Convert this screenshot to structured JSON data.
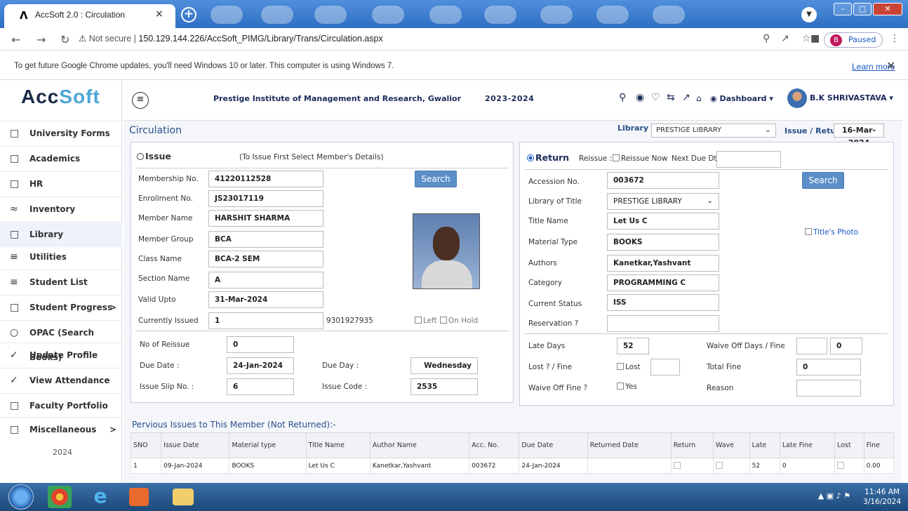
{
  "browser": {
    "tab_title": "AccSoft 2.0 : Circulation",
    "tab_logo": "Λ",
    "close_tab": "×",
    "new_tab": "+",
    "not_secure": "Not secure",
    "url": "150.129.144.226/AccSoft_PIMG/Library/Trans/Circulation.aspx",
    "profile_initial": "B",
    "profile_status": "Paused",
    "info_message": "To get future Google Chrome updates, you'll need Windows 10 or later. This computer is using Windows 7.",
    "learn_more": "Learn more"
  },
  "sidebar": {
    "brand_a": "Acc",
    "brand_b": "Soft",
    "items": [
      {
        "label": "University Forms",
        "icon": "□"
      },
      {
        "label": "Academics",
        "icon": "□"
      },
      {
        "label": "HR",
        "icon": "□"
      },
      {
        "label": "Inventory",
        "icon": "≈"
      },
      {
        "label": "Library",
        "icon": "□"
      },
      {
        "label": "Utilities",
        "icon": "≡"
      },
      {
        "label": "Student List",
        "icon": "≡"
      },
      {
        "label": "Student Progress",
        "icon": "□"
      },
      {
        "label": "OPAC (Search Books)",
        "icon": "○"
      },
      {
        "label": "Update Profile",
        "icon": "✓"
      },
      {
        "label": "View Attendance",
        "icon": "✓"
      },
      {
        "label": "Faculty Portfolio",
        "icon": "□"
      },
      {
        "label": "Miscellaneous",
        "icon": "□"
      }
    ],
    "arrow": ">",
    "year": "2024"
  },
  "header": {
    "institute": "Prestige Institute of Management and Research, Gwalior",
    "session": "2023-2024",
    "dashboard": "Dashboard",
    "user": "B.K SHRIVASTAVA"
  },
  "page": {
    "title": "Circulation",
    "library_label": "Library :",
    "library_value": "PRESTIGE LIBRARY",
    "issue_return_label": "Issue / Return Date :",
    "issue_return_date": "16-Mar-2024"
  },
  "issue": {
    "heading": "Issue",
    "hint": "(To Issue First Select Member's Details)",
    "search": "Search",
    "membership_label": "Membership No.",
    "membership_no": "41220112528",
    "enrollment_label": "Enrollment No.",
    "enrollment_no": "JS23017119",
    "member_name_label": "Member Name",
    "member_name": "HARSHIT SHARMA",
    "member_group_label": "Member Group",
    "member_group": "BCA",
    "class_label": "Class Name",
    "class_name": "BCA-2 SEM",
    "section_label": "Section Name",
    "section_name": "A",
    "valid_label": "Valid Upto",
    "valid_upto": "31-Mar-2024",
    "current_issued_label": "Currently Issued",
    "current_issued": "1",
    "phone": "9301927935",
    "left_label": "Left",
    "on_hold_label": "On Hold",
    "reissue_label": "No of Reissue",
    "reissue": "0",
    "due_date_label": "Due Date :",
    "due_date": "24-Jan-2024",
    "due_day_label": "Due Day :",
    "due_day": "Wednesday",
    "slip_label": "Issue Slip No. :",
    "slip_no": "6",
    "code_label": "Issue Code :",
    "issue_code": "2535"
  },
  "return": {
    "heading": "Return",
    "reissue_label": "Reissue :",
    "reissue_now": "Reissue Now",
    "next_due_label": "Next Due Dt.",
    "accession_label": "Accession No.",
    "accession_no": "003672",
    "search": "Search",
    "library_title_label": "Library of Title",
    "library_title": "PRESTIGE LIBRARY",
    "title_name_label": "Title Name",
    "title_name": "Let Us C",
    "titles_photo": "Title's Photo",
    "material_label": "Material Type",
    "material_type": "BOOKS",
    "authors_label": "Authors",
    "authors": "Kanetkar,Yashvant",
    "category_label": "Category",
    "category": "PROGRAMMING C",
    "status_label": "Current Status",
    "current_status": "ISS",
    "reservation_label": "Reservation ?",
    "late_days_label": "Late Days",
    "late_days": "52",
    "waive_days_label": "Waive Off Days / Fine",
    "waive_fine": "0",
    "lost_label": "Lost ? / Fine",
    "lost": "Lost",
    "total_fine_label": "Total Fine",
    "total_fine": "0",
    "waive_off_label": "Waive Off Fine ?",
    "yes": "Yes",
    "reason_label": "Reason"
  },
  "grid": {
    "title": "Pervious Issues to This Member (Not Returned):-",
    "headers": [
      "SNO",
      "Issue Date",
      "Material type",
      "Title Name",
      "Author Name",
      "Acc. No.",
      "Due Date",
      "Returned Date",
      "Return",
      "Wave",
      "Late",
      "Late Fine",
      "Lost",
      "Fine"
    ],
    "rows": [
      [
        "1",
        "09-Jan-2024",
        "BOOKS",
        "Let Us C",
        "Kanetkar,Yashvant",
        "003672",
        "24-Jan-2024",
        "",
        "",
        "",
        "52",
        "0",
        "",
        "0.00"
      ]
    ]
  },
  "taskbar": {
    "time": "11:46 AM",
    "date": "3/16/2024"
  }
}
